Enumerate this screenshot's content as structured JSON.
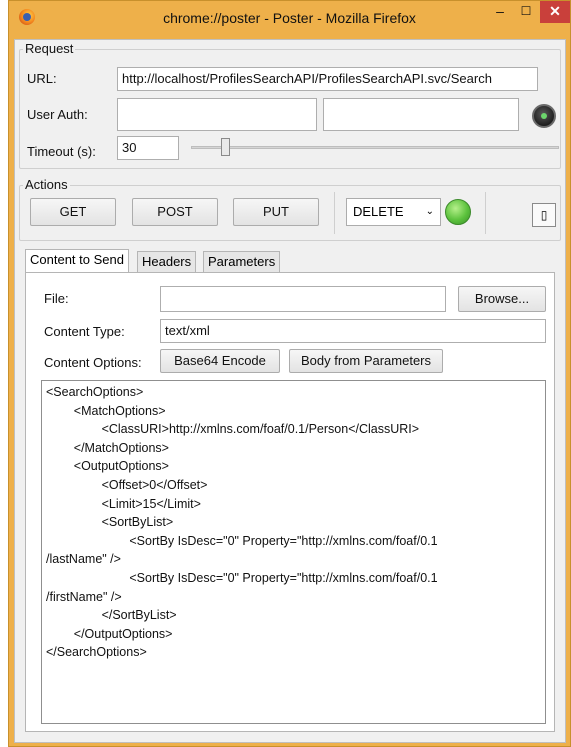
{
  "window": {
    "title": "chrome://poster - Poster - Mozilla Firefox",
    "min_glyph": "–",
    "max_glyph": "☐",
    "close_glyph": "✕"
  },
  "request": {
    "legend": "Request",
    "url_label": "URL:",
    "url_value": "http://localhost/ProfilesSearchAPI/ProfilesSearchAPI.svc/Search",
    "user_auth_label": "User Auth:",
    "user_value": "",
    "password_value": "",
    "timeout_label": "Timeout (s):",
    "timeout_value": "30"
  },
  "actions": {
    "legend": "Actions",
    "get_label": "GET",
    "post_label": "POST",
    "put_label": "PUT",
    "method_selected": "DELETE",
    "tool_glyph": "▯"
  },
  "tabs": [
    {
      "label": "Content to Send"
    },
    {
      "label": "Headers"
    },
    {
      "label": "Parameters"
    }
  ],
  "content": {
    "file_label": "File:",
    "file_value": "",
    "browse_label": "Browse...",
    "content_type_label": "Content Type:",
    "content_type_value": "text/xml",
    "content_options_label": "Content Options:",
    "base64_label": "Base64 Encode",
    "body_from_params_label": "Body from Parameters",
    "body_lines": [
      "<SearchOptions>",
      "        <MatchOptions>",
      "                <ClassURI>http://xmlns.com/foaf/0.1/Person</ClassURI>",
      "        </MatchOptions>",
      "        <OutputOptions>",
      "                <Offset>0</Offset>",
      "                <Limit>15</Limit>",
      "                <SortByList>",
      "                        <SortBy IsDesc=\"0\" Property=\"http://xmlns.com/foaf/0.1",
      "/lastName\" />",
      "                        <SortBy IsDesc=\"0\" Property=\"http://xmlns.com/foaf/0.1",
      "/firstName\" />",
      "                </SortByList>",
      "        </OutputOptions>",
      "</SearchOptions>"
    ]
  },
  "colors": {
    "titlebar": "#eeb04a",
    "close_button": "#c9403b",
    "status_green": "#5cc23d"
  }
}
